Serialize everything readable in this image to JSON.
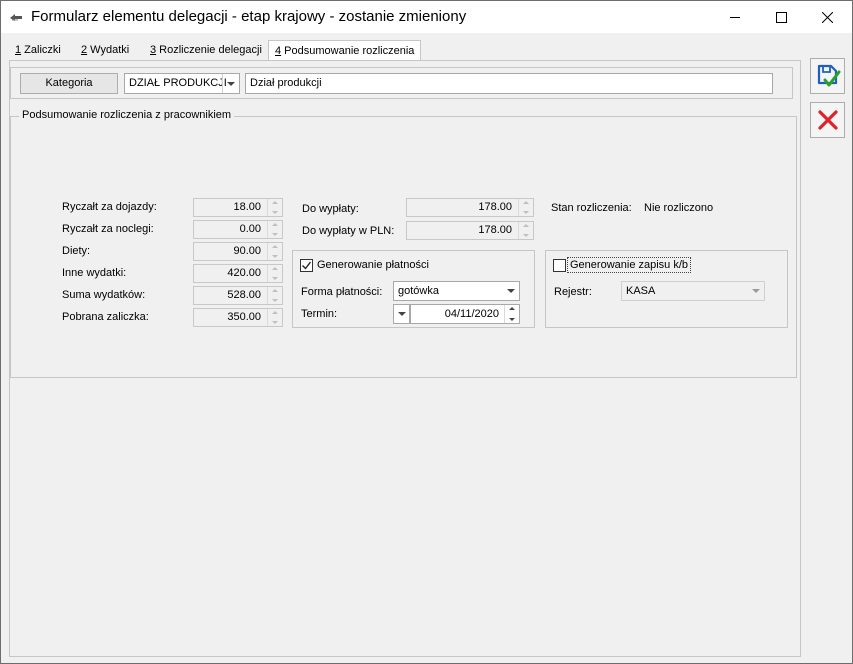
{
  "window": {
    "title": "Formularz elementu delegacji - etap krajowy - zostanie zmieniony",
    "minimize_glyph": "—",
    "maximize_glyph": "☐",
    "close_glyph": "✕"
  },
  "tabs": [
    {
      "num": "1",
      "label": " Zaliczki"
    },
    {
      "num": "2",
      "label": " Wydatki"
    },
    {
      "num": "3",
      "label": " Rozliczenie delegacji"
    },
    {
      "num": "4",
      "label": " Podsumowanie rozliczenia"
    }
  ],
  "category": {
    "button_label": "Kategoria",
    "code": "DZIAŁ PRODUKCJI",
    "description": "Dział produkcji"
  },
  "summary": {
    "group_title": "Podsumowanie rozliczenia z pracownikiem",
    "rows": [
      {
        "label": "Ryczałt za dojazdy:",
        "value": "18.00"
      },
      {
        "label": "Ryczałt za noclegi:",
        "value": "0.00"
      },
      {
        "label": "Diety:",
        "value": "90.00"
      },
      {
        "label": "Inne wydatki:",
        "value": "420.00"
      },
      {
        "label": "Suma wydatków:",
        "value": "528.00"
      },
      {
        "label": "Pobrana zaliczka:",
        "value": "350.00"
      }
    ],
    "payout_label": "Do wypłaty:",
    "payout_value": "178.00",
    "payout_pln_label": "Do wypłaty w PLN:",
    "payout_pln_value": "178.00",
    "status_label": "Stan rozliczenia:",
    "status_value": "Nie rozliczono"
  },
  "payment": {
    "checkbox_label": "Generowanie płatności",
    "checked": true,
    "form_label": "Forma płatności:",
    "form_value": "gotówka",
    "term_label": "Termin:",
    "term_value": "04/11/2020"
  },
  "cash_entry": {
    "checkbox_label": "Generowanie zapisu k/b",
    "checked": false,
    "register_label": "Rejestr:",
    "register_value": "KASA"
  },
  "side_buttons": [
    {
      "icon": "save-icon"
    },
    {
      "icon": "cancel-icon"
    }
  ],
  "colors": {
    "save_blue": "#1f5fbf",
    "save_green": "#2aa02a",
    "cancel_red": "#e0202a"
  }
}
